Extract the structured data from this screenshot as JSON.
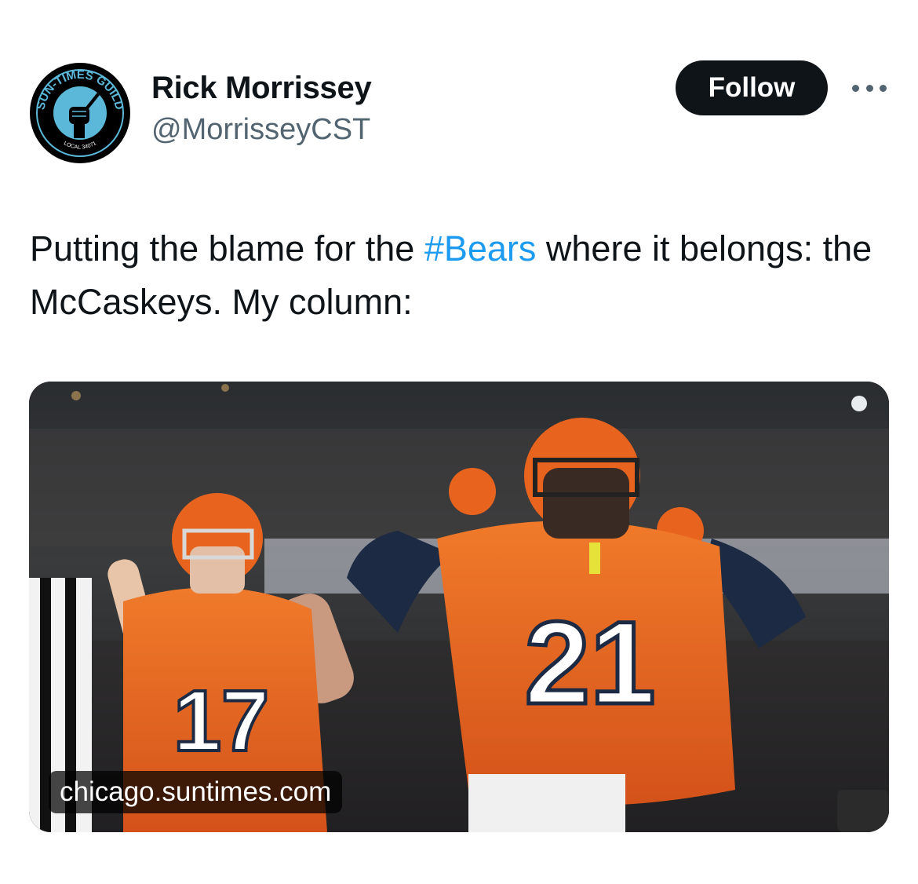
{
  "author": {
    "display_name": "Rick Morrissey",
    "handle": "@MorrisseyCST",
    "avatar_icon": "sun-times-guild-logo",
    "avatar_text_top": "SUN-TIMES GUILD",
    "avatar_text_bottom": "LOCAL 34071"
  },
  "actions": {
    "follow_label": "Follow",
    "more_icon": "more-horizontal-icon"
  },
  "tweet": {
    "text_before": "Putting the blame for the ",
    "hashtag": "#Bears",
    "text_after": " where it belongs: the McCaskeys. My column:"
  },
  "link_card": {
    "domain": "chicago.suntimes.com",
    "jersey_left": "17",
    "jersey_right": "21"
  },
  "colors": {
    "text_primary": "#0f1419",
    "text_secondary": "#536471",
    "hashtag": "#1d9bf0",
    "follow_bg": "#0f1419",
    "jersey_orange": "#e8641e",
    "navy": "#1c2a44"
  }
}
